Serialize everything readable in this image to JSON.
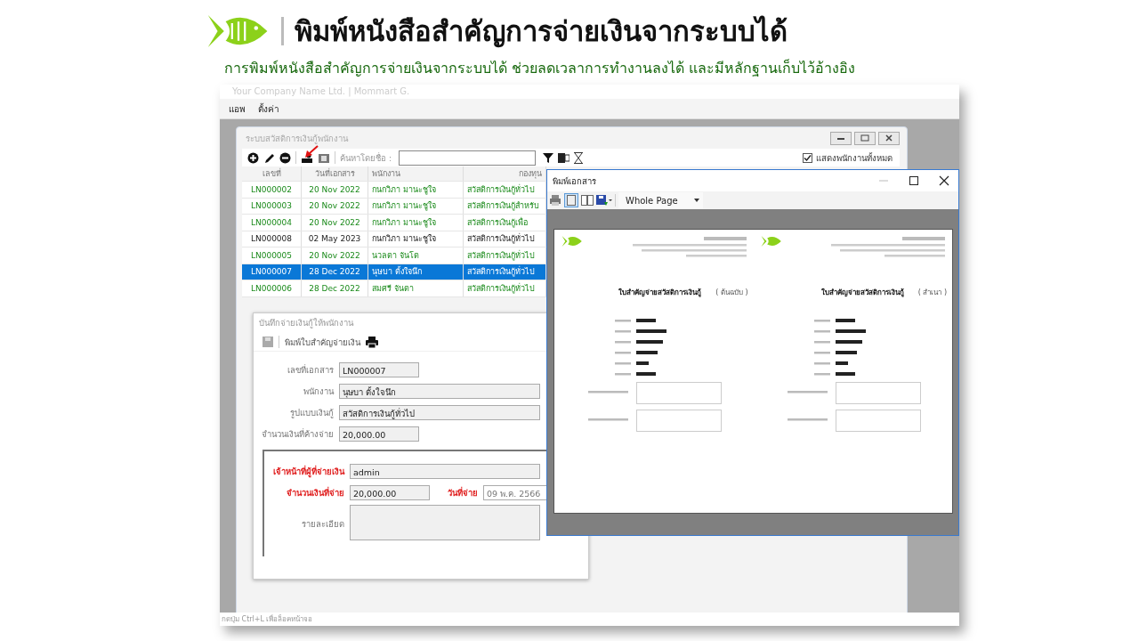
{
  "header": {
    "title": "พิมพ์หนังสือสำคัญการจ่ายเงินจากระบบได้",
    "subtitle": "การพิมพ์หนังสือสำคัญการจ่ายเงินจากระบบได้ ช่วยลดเวลาการทำงานลงได้ และมีหลักฐานเก็บไว้อ้างอิง"
  },
  "app": {
    "title": "Your Company Name Ltd. | Mommart G.",
    "menu": [
      "แอพ",
      "ตั้งค่า"
    ],
    "status_bar": "กดปุ่ม Ctrl+L เพื่อล็อคหน้าจอ"
  },
  "list_window": {
    "title": "ระบบสวัสดิการเงินกู้พนักงาน",
    "search_label": "ค้นหาโดยชื่อ :",
    "show_all": {
      "label": "แสดงพนักงานทั้งหมด",
      "checked": true
    },
    "columns": [
      "เลขที่",
      "วันที่เอกสาร",
      "พนักงาน",
      "กองทุน"
    ],
    "rows": [
      {
        "cells": [
          "LN000002",
          "20 Nov 2022",
          "กนกวิภา มานะชูใจ",
          "สวัสดิการเงินกู้ทั่วไป"
        ],
        "kind": "highlight",
        "selected": false
      },
      {
        "cells": [
          "LN000003",
          "20 Nov 2022",
          "กนกวิภา มานะชูใจ",
          "สวัสดิการเงินกู้สำหรับ"
        ],
        "kind": "highlight",
        "selected": false
      },
      {
        "cells": [
          "LN000004",
          "20 Nov 2022",
          "กนกวิภา มานะชูใจ",
          "สวัสดิการเงินกู้เพื่อ"
        ],
        "kind": "highlight",
        "selected": false
      },
      {
        "cells": [
          "LN000008",
          "02 May 2023",
          "กนกวิภา มานะชูใจ",
          "สวัสดิการเงินกู้ทั่วไป"
        ],
        "kind": "plain",
        "selected": false
      },
      {
        "cells": [
          "LN000005",
          "20 Nov 2022",
          "นวลตา จันโต",
          "สวัสดิการเงินกู้ทั่วไป"
        ],
        "kind": "highlight",
        "selected": false
      },
      {
        "cells": [
          "LN000007",
          "28 Dec 2022",
          "นุษบา ตั้งใจนึก",
          "สวัสดิการเงินกู้ทั่วไป"
        ],
        "selected": true
      },
      {
        "cells": [
          "LN000006",
          "28 Dec 2022",
          "สมศรี จันตา",
          "สวัสดิการเงินกู้ทั่วไป"
        ],
        "kind": "highlight",
        "selected": false
      }
    ]
  },
  "form_window": {
    "title": "บันทึกจ่ายเงินกู้ให้พนักงาน",
    "print_label": "พิมพ์ใบสำคัญจ่ายเงิน",
    "fields": [
      {
        "label": "เลขที่เอกสาร",
        "value": "LN000007",
        "kind": "short"
      },
      {
        "label": "พนักงาน",
        "value": "นุษบา ตั้งใจนึก",
        "kind": "wide"
      },
      {
        "label": "รูปแบบเงินกู้",
        "value": "สวัสดิการเงินกู้ทั่วไป",
        "kind": "wide"
      },
      {
        "label": "จำนวนเงินที่ค้างจ่าย",
        "value": "20,000.00",
        "kind": "short"
      }
    ],
    "payment": {
      "officer_label": "เจ้าหน้าที่ผู้ที่จ่ายเงิน",
      "officer": "admin",
      "amount_label": "จำนวนเงินที่จ่าย",
      "amount": "20,000.00",
      "date_label": "วันที่จ่าย",
      "date": "09 พ.ค.  2566",
      "detail_label": "รายละเอียด"
    }
  },
  "preview_window": {
    "title": "พิมพ์เอกสาร",
    "zoom": "Whole Page",
    "pages": [
      {
        "title": "ใบสำคัญจ่ายสวัสดิการเงินกู้",
        "copy": "( ต้นฉบับ )"
      },
      {
        "title": "ใบสำคัญจ่ายสวัสดิการเงินกู้",
        "copy": "( สำเนา )"
      }
    ]
  }
}
